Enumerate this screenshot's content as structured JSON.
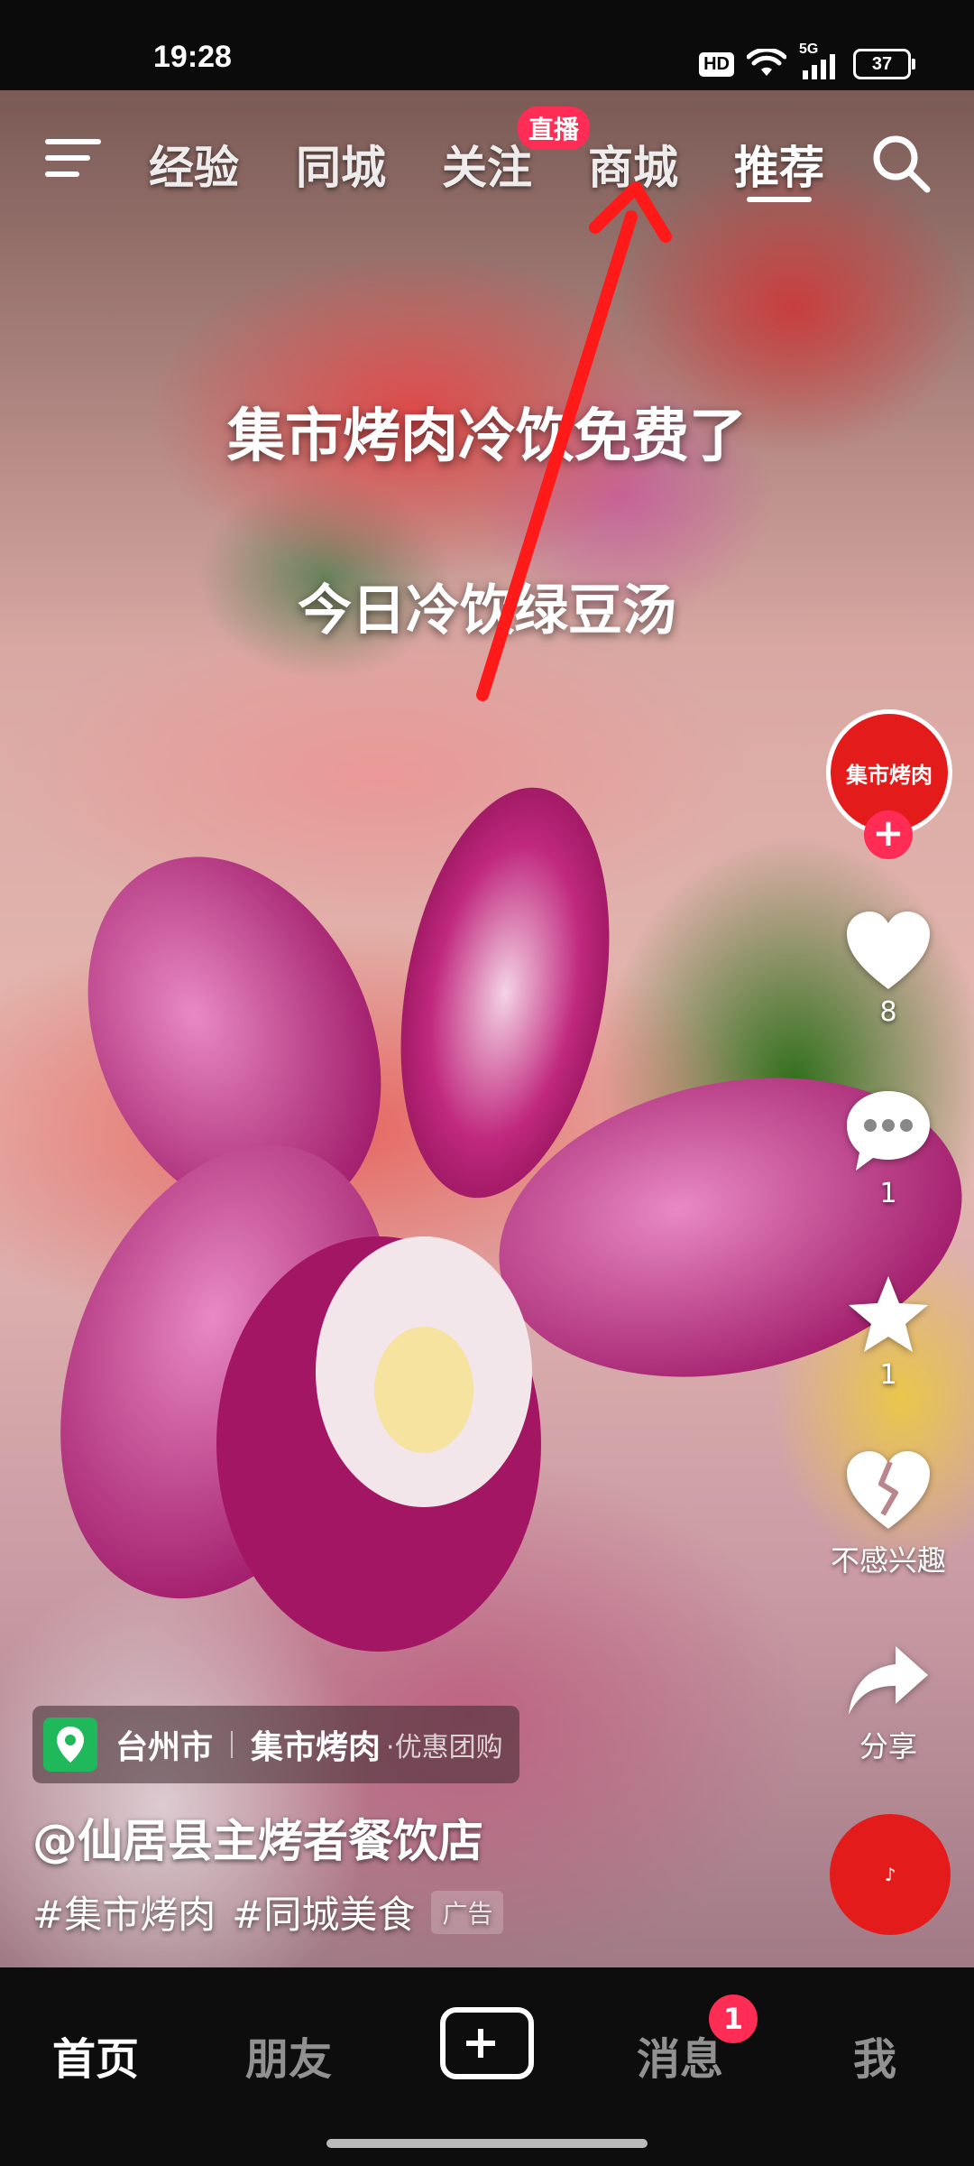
{
  "status_bar": {
    "time": "19:28",
    "hd_label": "HD",
    "network_label": "5G",
    "battery": "37"
  },
  "top_nav": {
    "tabs": [
      {
        "label": "经验"
      },
      {
        "label": "同城"
      },
      {
        "label": "关注"
      },
      {
        "label": "商城"
      },
      {
        "label": "推荐"
      }
    ],
    "active_tab": "推荐",
    "live_badge": "直播"
  },
  "video": {
    "captions": [
      "集市烤肉冷饮免费了",
      "今日冷饮绿豆汤"
    ],
    "annotation": "red arrow pointing to 商城 tab"
  },
  "side_actions": {
    "avatar_text": "集市烤肉",
    "follow_plus": "+",
    "like_count": "8",
    "comment_count": "1",
    "favorite_count": "1",
    "not_interested_label": "不感兴趣",
    "share_label": "分享"
  },
  "location_tag": {
    "city": "台州市",
    "name": "集市烤肉",
    "promo": "·优惠团购"
  },
  "author": "@仙居县主烤者餐饮店",
  "tags": [
    "#集市烤肉",
    "#同城美食"
  ],
  "ad_label": "广告",
  "bottom_nav": {
    "items": [
      {
        "label": "首页"
      },
      {
        "label": "朋友"
      },
      {
        "label": "消息"
      },
      {
        "label": "我"
      }
    ],
    "message_badge": "1"
  },
  "colors": {
    "accent": "#ff2c55",
    "location_icon": "#1fb85a",
    "arrow": "#ff1a1a"
  }
}
